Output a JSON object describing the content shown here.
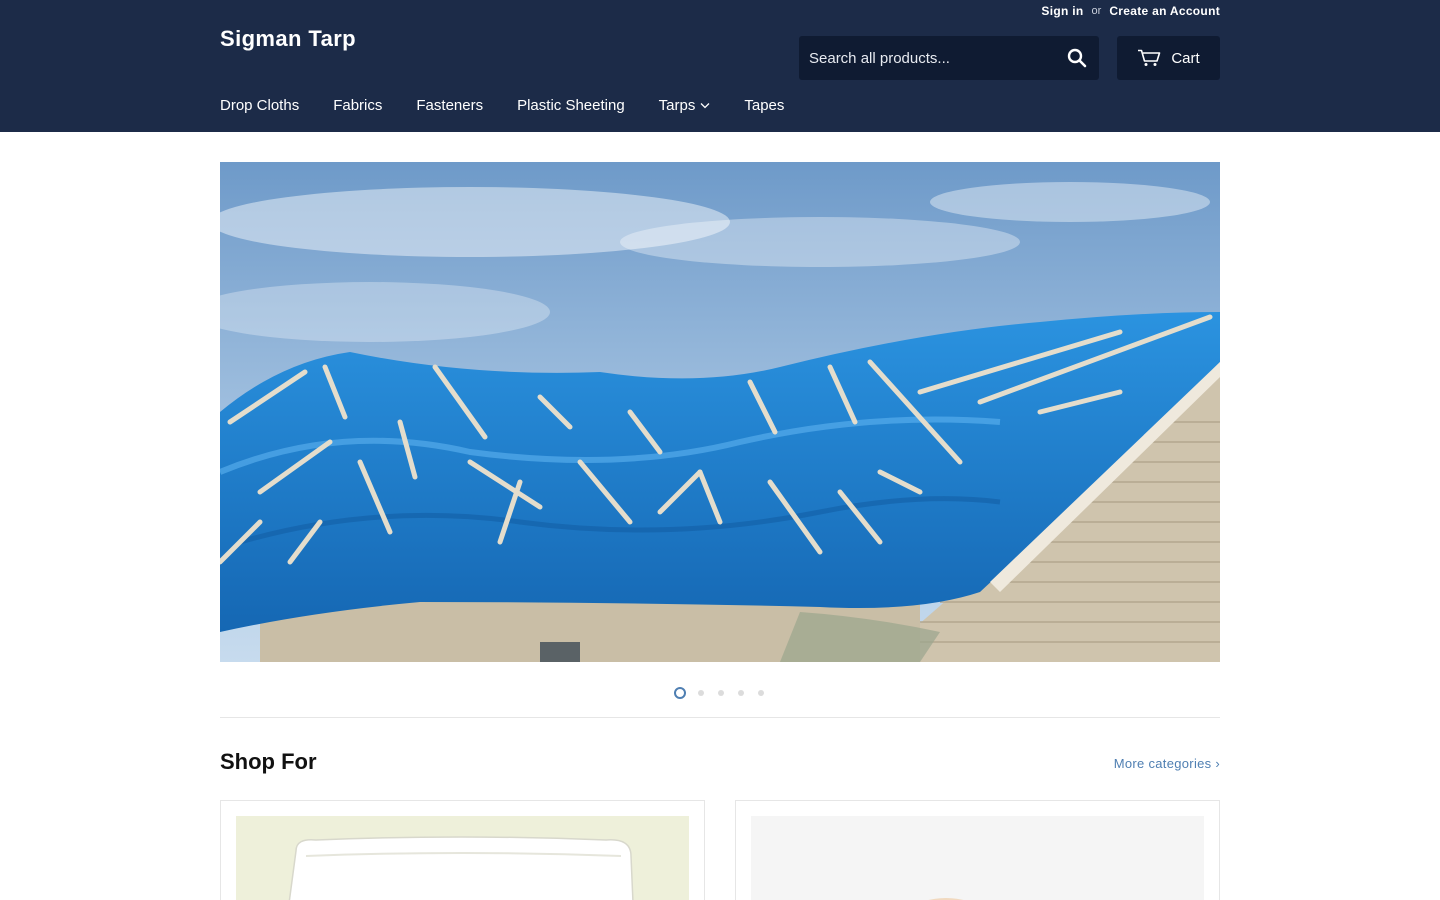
{
  "header": {
    "account": {
      "sign_in": "Sign in",
      "or": "or",
      "create_account": "Create an Account"
    },
    "logo": "Sigman Tarp",
    "search": {
      "placeholder": "Search all products..."
    },
    "cart_label": "Cart"
  },
  "nav": {
    "items": [
      {
        "label": "Drop Cloths"
      },
      {
        "label": "Fabrics"
      },
      {
        "label": "Fasteners"
      },
      {
        "label": "Plastic Sheeting"
      },
      {
        "label": "Tarps"
      },
      {
        "label": "Tapes"
      }
    ]
  },
  "slideshow": {
    "slide_count": 5,
    "active_index": 0
  },
  "shop_for": {
    "title": "Shop For",
    "more_label": "More categories ›"
  },
  "colors": {
    "header_bg": "#1c2b48",
    "search_bg": "#0f1b32",
    "link_accent": "#4f7fb2",
    "tarp_blue": "#1f86d6"
  },
  "icons": {
    "search": "search-icon",
    "cart": "cart-icon",
    "dropdown": "chevron-down-icon"
  }
}
